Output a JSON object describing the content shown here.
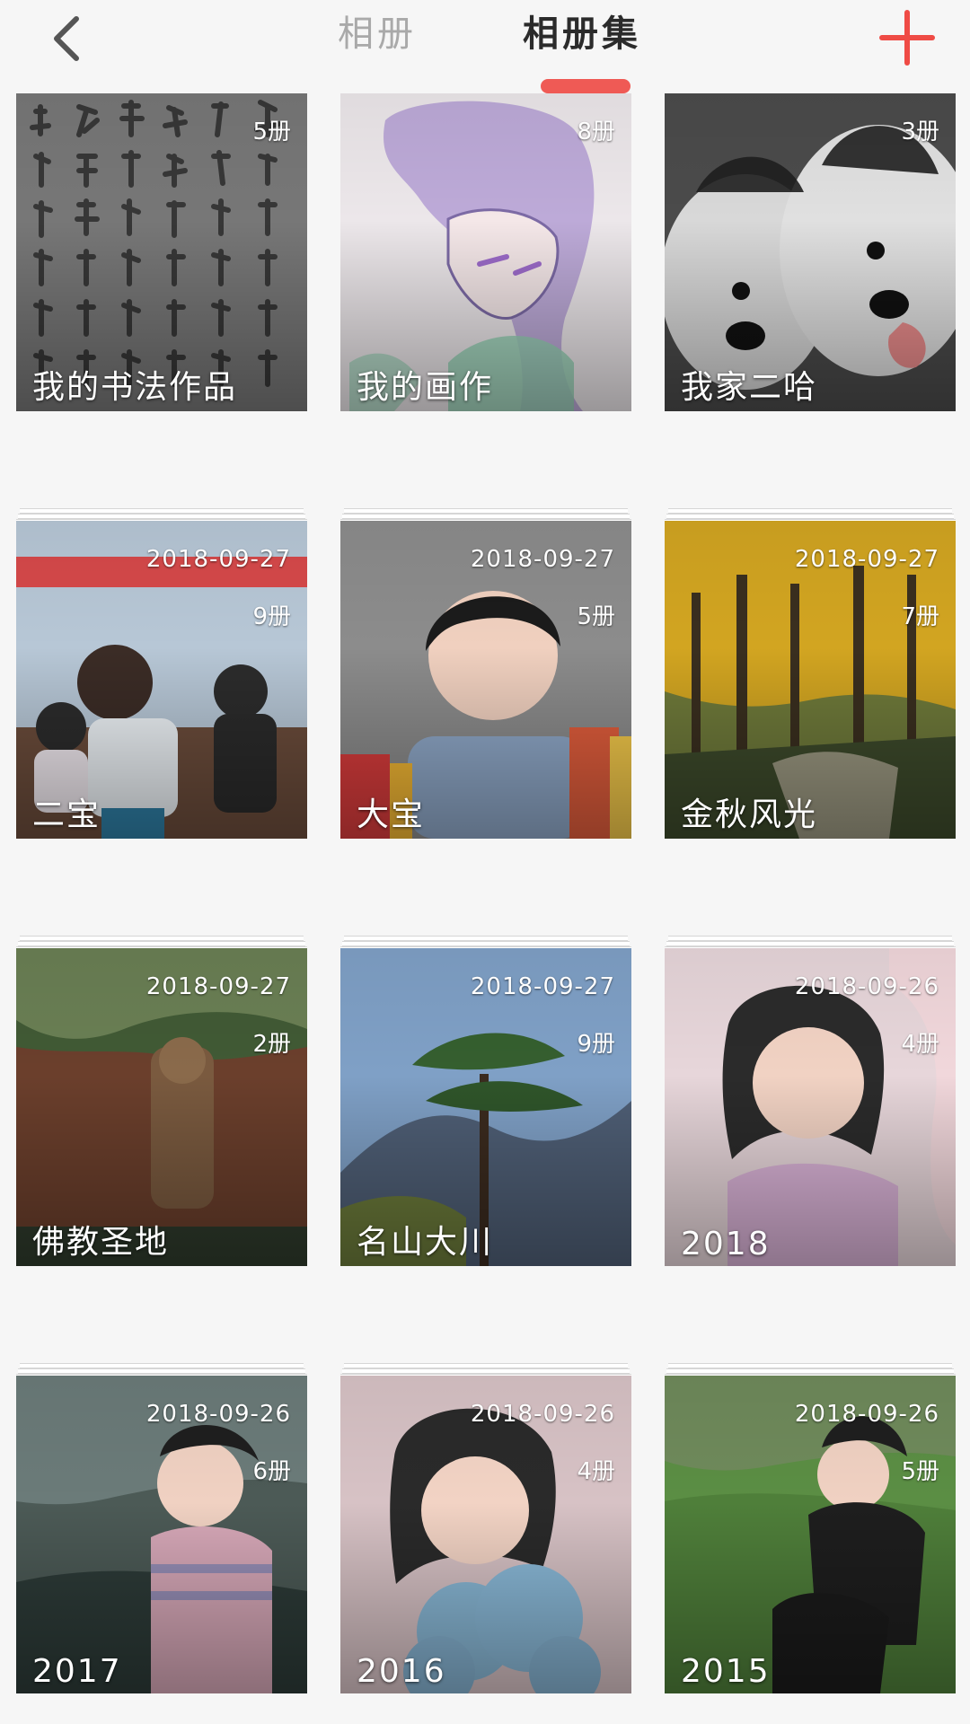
{
  "header": {
    "tab_album": "相册",
    "tab_album_set": "相册集",
    "accent_color": "#ef5a55",
    "icons": [
      "chevron-left-icon",
      "plus-icon"
    ]
  },
  "albums": [
    {
      "title": "我的书法作品",
      "count": "5册",
      "date": ""
    },
    {
      "title": "我的画作",
      "count": "8册",
      "date": ""
    },
    {
      "title": "我家二哈",
      "count": "3册",
      "date": ""
    },
    {
      "title": "二宝",
      "count": "9册",
      "date": "2018-09-27"
    },
    {
      "title": "大宝",
      "count": "5册",
      "date": "2018-09-27"
    },
    {
      "title": "金秋风光",
      "count": "7册",
      "date": "2018-09-27"
    },
    {
      "title": "佛教圣地",
      "count": "2册",
      "date": "2018-09-27"
    },
    {
      "title": "名山大川",
      "count": "9册",
      "date": "2018-09-27"
    },
    {
      "title": "2018",
      "count": "4册",
      "date": "2018-09-26"
    },
    {
      "title": "2017",
      "count": "6册",
      "date": "2018-09-26"
    },
    {
      "title": "2016",
      "count": "4册",
      "date": "2018-09-26"
    },
    {
      "title": "2015",
      "count": "5册",
      "date": "2018-09-26"
    }
  ]
}
